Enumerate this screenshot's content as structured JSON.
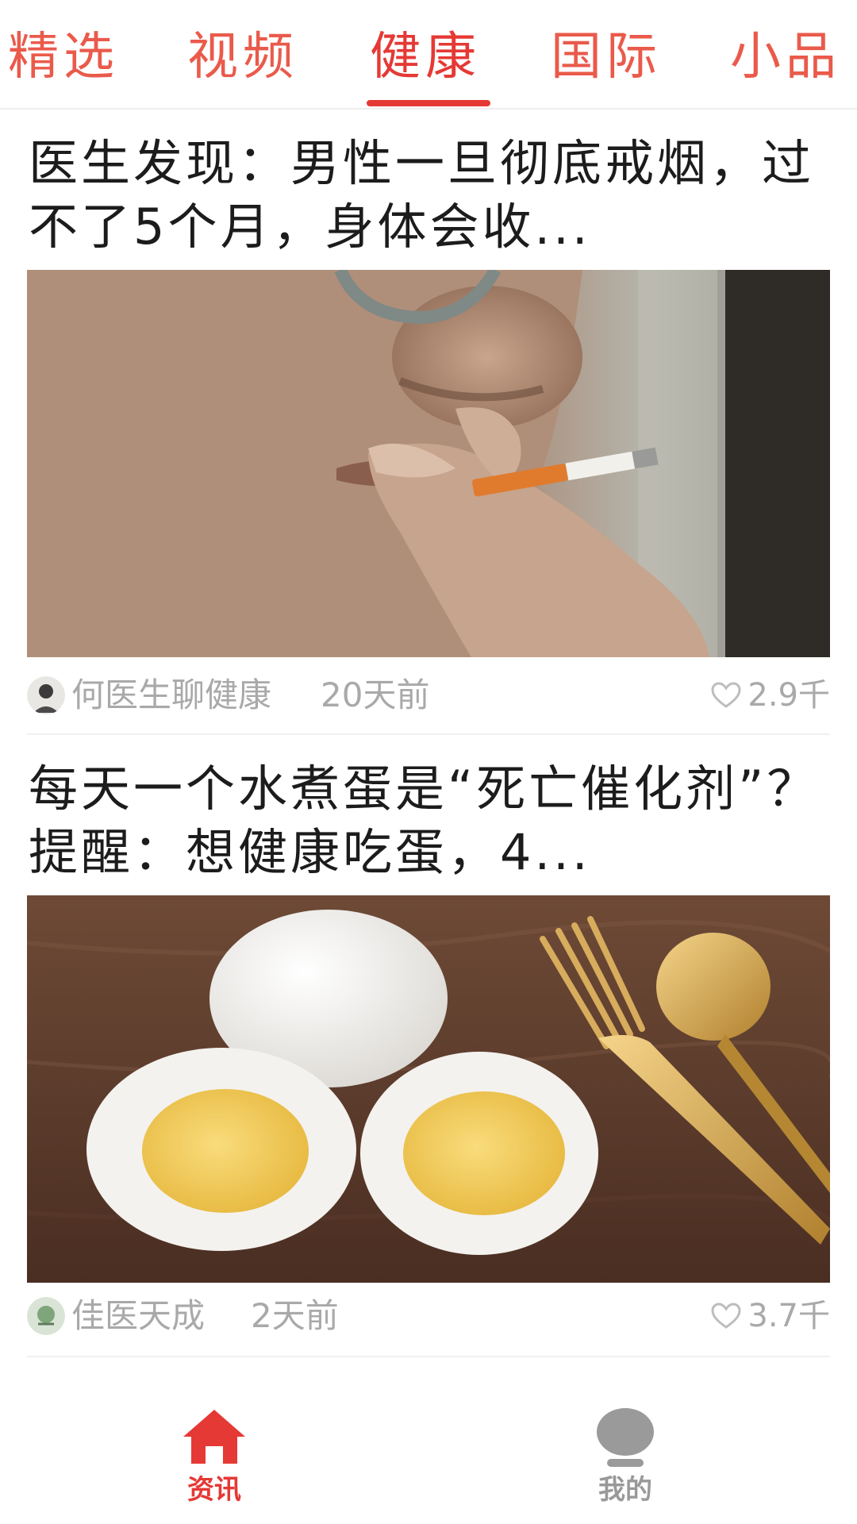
{
  "tabs": [
    {
      "label": "精选"
    },
    {
      "label": "视频"
    },
    {
      "label": "健康"
    },
    {
      "label": "国际"
    },
    {
      "label": "小品"
    }
  ],
  "active_tab": "健康",
  "articles": [
    {
      "title": "医生发现：男性一旦彻底戒烟，过不了5个月，身体会收...",
      "image": "man-smoking-cigarette-photo",
      "author": "何医生聊健康",
      "time": "20天前",
      "likes": "2.9千"
    },
    {
      "title": "每天一个水煮蛋是“死亡催化剂”？提醒：想健康吃蛋，4...",
      "image": "boiled-eggs-with-fork-and-spoon-photo",
      "author": "佳医天成",
      "time": "2天前",
      "likes": "3.7千"
    }
  ],
  "bottom_nav": {
    "home_label": "资讯",
    "me_label": "我的"
  },
  "colors": {
    "accent": "#e53935",
    "tab_text": "#ea5a4b",
    "meta_text": "#a9a9a9",
    "title_text": "#1c1c1c"
  },
  "icons": {
    "heart": "heart-outline-icon",
    "home": "home-icon",
    "me": "user-icon"
  }
}
